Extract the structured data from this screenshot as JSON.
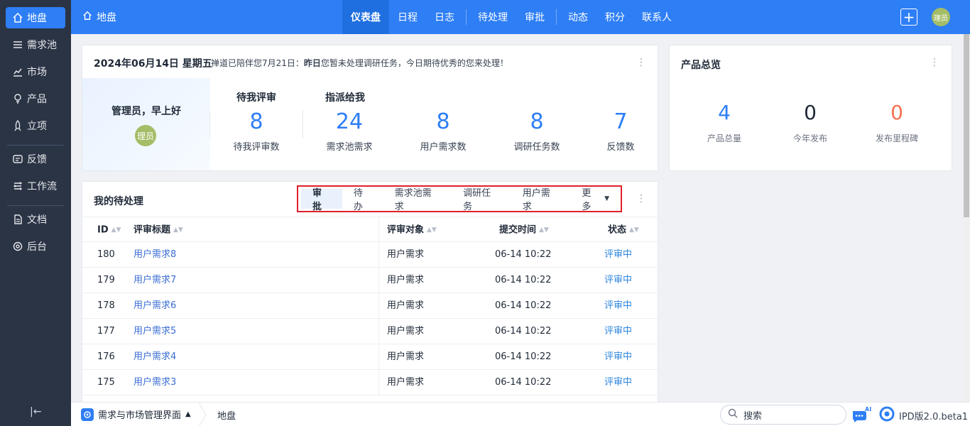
{
  "sidebar": {
    "items": [
      {
        "label": "地盘",
        "icon": "home-icon",
        "active": true
      },
      {
        "label": "需求池",
        "icon": "list-icon"
      },
      {
        "label": "市场",
        "icon": "chart-icon"
      },
      {
        "label": "产品",
        "icon": "bulb-icon"
      },
      {
        "label": "立项",
        "icon": "rocket-icon"
      },
      {
        "label": "反馈",
        "icon": "feedback-icon"
      },
      {
        "label": "工作流",
        "icon": "flow-icon"
      },
      {
        "label": "文档",
        "icon": "doc-icon"
      },
      {
        "label": "后台",
        "icon": "gear-icon"
      }
    ],
    "collapse_glyph": "|←"
  },
  "topbar": {
    "crumb": "地盘",
    "nav": [
      "仪表盘",
      "日程",
      "日志",
      "待处理",
      "审批",
      "动态",
      "积分",
      "联系人"
    ],
    "active_nav": "仪表盘",
    "plus": "+",
    "avatar": "理员"
  },
  "welcome": {
    "date": "2024年06月14日 星期五",
    "msg_prefix": "禅道已陪伴您7月21日：",
    "msg_bold": "昨日",
    "msg_suffix": "您暂未处理调研任务，今日期待优秀的您来处理！",
    "greeting": "管理员，早上好",
    "avatar": "理员",
    "section_review": "待我评审",
    "section_assigned": "指派给我",
    "stats": [
      {
        "num": "8",
        "label": "待我评审数"
      },
      {
        "num": "24",
        "label": "需求池需求"
      },
      {
        "num": "8",
        "label": "用户需求数"
      },
      {
        "num": "8",
        "label": "调研任务数"
      },
      {
        "num": "7",
        "label": "反馈数"
      }
    ]
  },
  "overview": {
    "title": "产品总览",
    "stats": [
      {
        "num": "4",
        "label": "产品总量",
        "color": "#2e7ef5"
      },
      {
        "num": "0",
        "label": "今年发布",
        "color": "#1f2937"
      },
      {
        "num": "0",
        "label": "发布里程碑",
        "color": "#f5714f"
      }
    ]
  },
  "todo": {
    "title": "我的待处理",
    "tabs": [
      "审批",
      "待办",
      "需求池需求",
      "调研任务",
      "用户需求",
      "更多"
    ],
    "active_tab": "审批",
    "columns": [
      "ID",
      "评审标题",
      "评审对象",
      "提交时间",
      "状态"
    ],
    "rows": [
      {
        "id": "180",
        "title": "用户需求8",
        "object": "用户需求",
        "time": "06-14 10:22",
        "status": "评审中"
      },
      {
        "id": "179",
        "title": "用户需求7",
        "object": "用户需求",
        "time": "06-14 10:22",
        "status": "评审中"
      },
      {
        "id": "178",
        "title": "用户需求6",
        "object": "用户需求",
        "time": "06-14 10:22",
        "status": "评审中"
      },
      {
        "id": "177",
        "title": "用户需求5",
        "object": "用户需求",
        "time": "06-14 10:22",
        "status": "评审中"
      },
      {
        "id": "176",
        "title": "用户需求4",
        "object": "用户需求",
        "time": "06-14 10:22",
        "status": "评审中"
      },
      {
        "id": "175",
        "title": "用户需求3",
        "object": "用户需求",
        "time": "06-14 10:22",
        "status": "评审中"
      }
    ]
  },
  "bottombar": {
    "app": "需求与市场管理界面",
    "crumb": "地盘",
    "search_placeholder": "搜索",
    "ai_label": "AI",
    "version": "IPD版2.0.beta1"
  },
  "colors": {
    "accent": "#2e7ef5",
    "sidebar_bg": "#2b3445",
    "highlight_border": "#e0202a",
    "milestone_orange": "#f5714f"
  }
}
